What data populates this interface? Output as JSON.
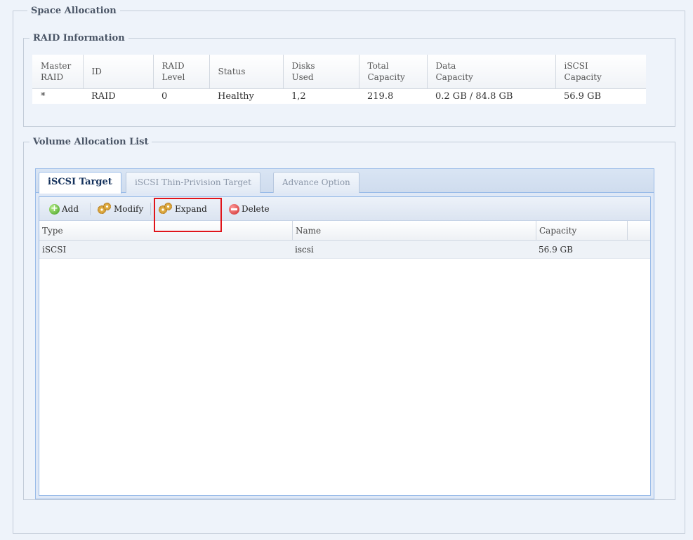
{
  "space_allocation": {
    "legend": "Space Allocation",
    "raid_info": {
      "legend": "RAID Information",
      "headers": [
        "Master\nRAID",
        "ID",
        "RAID\nLevel",
        "Status",
        "Disks\nUsed",
        "Total\nCapacity",
        "Data\nCapacity",
        "iSCSI\nCapacity"
      ],
      "row": {
        "master": "*",
        "id": "RAID",
        "level": "0",
        "status": "Healthy",
        "disks": "1,2",
        "total": "219.8",
        "data": "0.2 GB / 84.8 GB",
        "iscsi": "56.9 GB"
      }
    },
    "volume_list": {
      "legend": "Volume Allocation List",
      "tabs": [
        {
          "label": "iSCSI Target",
          "active": true
        },
        {
          "label": "iSCSI Thin-Privision Target",
          "active": false
        },
        {
          "label": "Advance Option",
          "active": false
        }
      ],
      "toolbar": {
        "add": "Add",
        "modify": "Modify",
        "expand": "Expand",
        "delete": "Delete"
      },
      "columns": {
        "type": "Type",
        "name": "Name",
        "capacity": "Capacity"
      },
      "rows": [
        {
          "type": "iSCSI",
          "name": "iscsi",
          "capacity": "56.9 GB"
        }
      ]
    }
  },
  "colors": {
    "highlight": "#e0141a",
    "tab_border": "#99bbe8",
    "page_bg": "#eef3fa"
  }
}
